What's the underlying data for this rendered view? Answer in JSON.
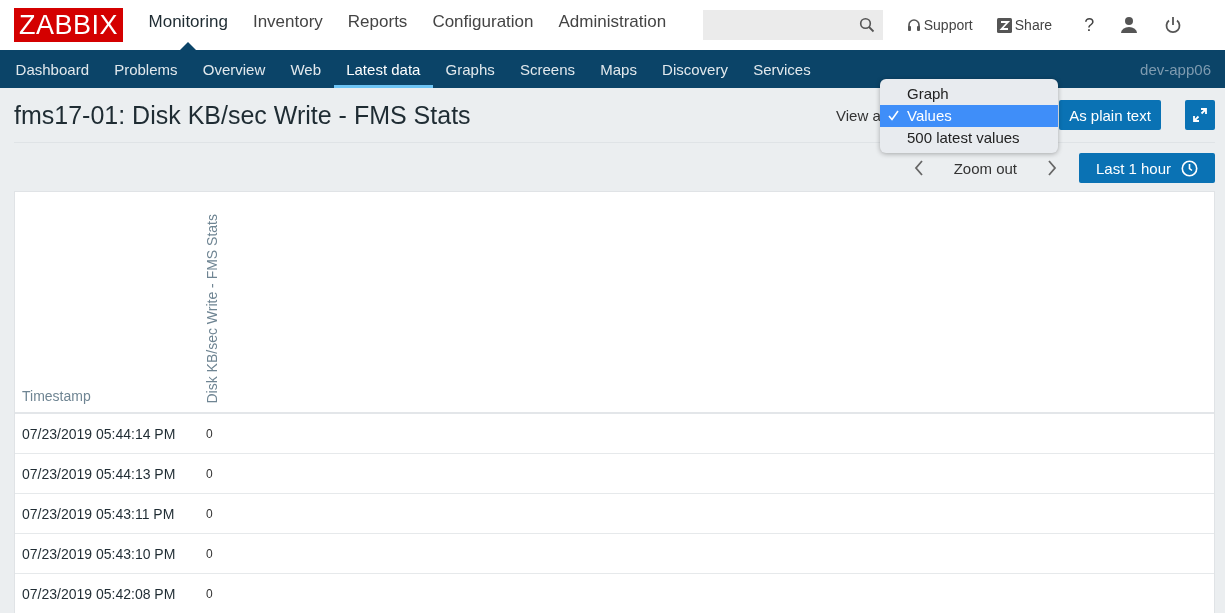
{
  "logo": "ZABBIX",
  "main_menu": [
    {
      "label": "Monitoring",
      "selected": true
    },
    {
      "label": "Inventory",
      "selected": false
    },
    {
      "label": "Reports",
      "selected": false
    },
    {
      "label": "Configuration",
      "selected": false
    },
    {
      "label": "Administration",
      "selected": false
    }
  ],
  "header_links": [
    {
      "label": "Support",
      "kind": "support"
    },
    {
      "label": "Share",
      "kind": "share"
    },
    {
      "label": "?",
      "kind": "help"
    }
  ],
  "sub_menu": [
    {
      "label": "Dashboard",
      "selected": false
    },
    {
      "label": "Problems",
      "selected": false
    },
    {
      "label": "Overview",
      "selected": false
    },
    {
      "label": "Web",
      "selected": false
    },
    {
      "label": "Latest data",
      "selected": true
    },
    {
      "label": "Graphs",
      "selected": false
    },
    {
      "label": "Screens",
      "selected": false
    },
    {
      "label": "Maps",
      "selected": false
    },
    {
      "label": "Discovery",
      "selected": false
    },
    {
      "label": "Services",
      "selected": false
    }
  ],
  "server_name": "dev-app06",
  "page_title": "fms17-01: Disk KB/sec Write - FMS Stats",
  "view_as": {
    "label": "View a",
    "options": [
      {
        "label": "Graph",
        "selected": false
      },
      {
        "label": "Values",
        "selected": true
      },
      {
        "label": "500 latest values",
        "selected": false
      }
    ]
  },
  "plain_text_button": "As plain text",
  "zoom_out": "Zoom out",
  "time_button": "Last 1 hour",
  "table": {
    "columns": [
      "Timestamp",
      "Disk KB/sec Write - FMS Stats"
    ],
    "rows": [
      [
        "07/23/2019 05:44:14 PM",
        "0"
      ],
      [
        "07/23/2019 05:44:13 PM",
        "0"
      ],
      [
        "07/23/2019 05:43:11 PM",
        "0"
      ],
      [
        "07/23/2019 05:43:10 PM",
        "0"
      ],
      [
        "07/23/2019 05:42:08 PM",
        "0"
      ]
    ]
  }
}
